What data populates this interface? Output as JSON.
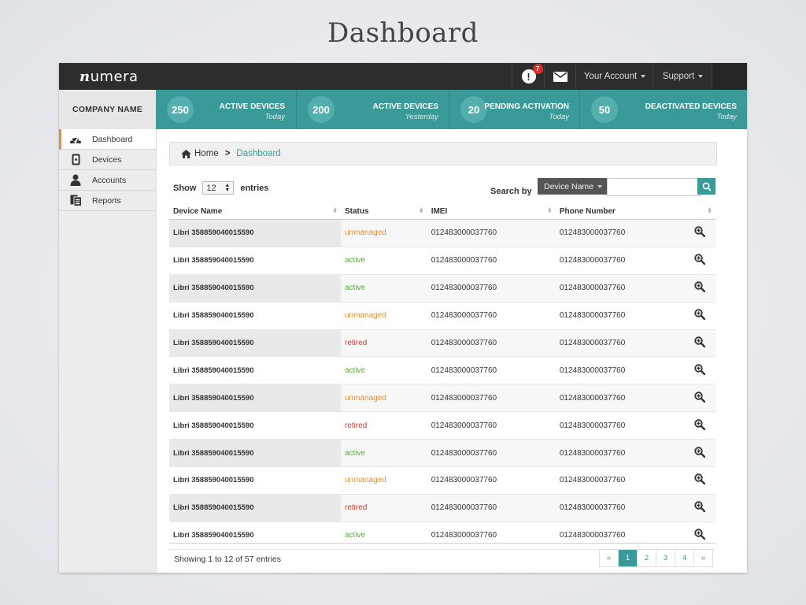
{
  "slide_title": "Dashboard",
  "topbar": {
    "logo_prefix": "n",
    "logo_rest": "umera",
    "alert_count": "7",
    "account_label": "Your Account",
    "support_label": "Support"
  },
  "company_name": "COMPANY NAME",
  "stats": [
    {
      "value": "250",
      "label": "ACTIVE DEVICES",
      "sub": "Today"
    },
    {
      "value": "200",
      "label": "ACTIVE DEVICES",
      "sub": "Yesterday"
    },
    {
      "value": "20",
      "label": "PENDING ACTIVATION",
      "sub": "Today"
    },
    {
      "value": "50",
      "label": "DEACTIVATED DEVICES",
      "sub": "Today"
    }
  ],
  "sidebar": {
    "items": [
      {
        "label": "Dashboard",
        "icon": "dashboard-icon",
        "active": true
      },
      {
        "label": "Devices",
        "icon": "device-icon"
      },
      {
        "label": "Accounts",
        "icon": "user-icon"
      },
      {
        "label": "Reports",
        "icon": "reports-icon"
      }
    ]
  },
  "breadcrumb": {
    "home": "Home",
    "current": "Dashboard"
  },
  "table_controls": {
    "show_label": "Show",
    "show_value": "12",
    "entries_label": "entries",
    "search_label": "Search by",
    "search_field": "Device Name",
    "search_placeholder": ""
  },
  "table": {
    "columns": [
      "Device Name",
      "Status",
      "IMEI",
      "Phone Number"
    ],
    "rows": [
      {
        "name": "Libri 358859040015590",
        "status": "unmanaged",
        "imei": "012483000037760",
        "phone": "012483000037760"
      },
      {
        "name": "Libri 358859040015590",
        "status": "active",
        "imei": "012483000037760",
        "phone": "012483000037760"
      },
      {
        "name": "Libri 358859040015590",
        "status": "active",
        "imei": "012483000037760",
        "phone": "012483000037760"
      },
      {
        "name": "Libri 358859040015590",
        "status": "unmanaged",
        "imei": "012483000037760",
        "phone": "012483000037760"
      },
      {
        "name": "Libri 358859040015590",
        "status": "retired",
        "imei": "012483000037760",
        "phone": "012483000037760"
      },
      {
        "name": "Libri 358859040015590",
        "status": "active",
        "imei": "012483000037760",
        "phone": "012483000037760"
      },
      {
        "name": "Libri 358859040015590",
        "status": "unmanaged",
        "imei": "012483000037760",
        "phone": "012483000037760"
      },
      {
        "name": "Libri 358859040015590",
        "status": "retired",
        "imei": "012483000037760",
        "phone": "012483000037760"
      },
      {
        "name": "Libri 358859040015590",
        "status": "active",
        "imei": "012483000037760",
        "phone": "012483000037760"
      },
      {
        "name": "Libri 358859040015590",
        "status": "unmanaged",
        "imei": "012483000037760",
        "phone": "012483000037760"
      },
      {
        "name": "Libri 358859040015590",
        "status": "retired",
        "imei": "012483000037760",
        "phone": "012483000037760"
      },
      {
        "name": "Libri 358859040015590",
        "status": "active",
        "imei": "012483000037760",
        "phone": "012483000037760"
      }
    ]
  },
  "footer": {
    "showing": "Showing 1 to 12 of 57 entries",
    "pages": [
      "«",
      "1",
      "2",
      "3",
      "4",
      "»"
    ],
    "current_page": "1"
  },
  "colors": {
    "accent": "#3a9a98",
    "topbar": "#2d2d2d",
    "unmanaged": "#e4922e",
    "active": "#5aa83e",
    "retired": "#d03a32"
  }
}
